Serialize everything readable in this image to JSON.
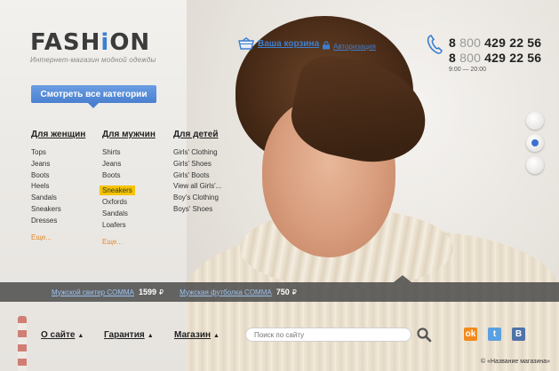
{
  "logo": {
    "word_pre": "FASH",
    "word_i": "i",
    "word_post": "ON",
    "tagline": "Интернет-магазин модной одежды"
  },
  "header": {
    "cart_label": "Ваша корзина",
    "auth_label": "Авторизация",
    "phones": [
      {
        "prefix": "8",
        "code": "800",
        "number": "429 22 56"
      },
      {
        "prefix": "8",
        "code": "800",
        "number": "429 22 56"
      }
    ],
    "hours": "9:00 — 20:00"
  },
  "categories_button": "Смотреть все категории",
  "columns": [
    {
      "title": "Для женщин",
      "items": [
        "Tops",
        "Jeans",
        "Boots",
        "Heels",
        "Sandals",
        "Sneakers",
        "Dresses"
      ],
      "more": "Еще..."
    },
    {
      "title": "Для мужчин",
      "items": [
        "Shirts",
        "Jeans",
        "Boots",
        "Sneakers",
        "Oxfords",
        "Sandals",
        "Loafers"
      ],
      "highlighted_index": 3,
      "more": "Еще..."
    },
    {
      "title": "Для детей",
      "items": [
        "Girls' Clothing",
        "Girls' Shoes",
        "Girls' Boots",
        "View all Girls'...",
        "Boy's Clothing",
        "Boys' Shoes"
      ]
    }
  ],
  "slider": {
    "count": 3,
    "active_index": 1
  },
  "promos": [
    {
      "name": "Мужской свитер COMMA",
      "price": "1599",
      "currency": "₽"
    },
    {
      "name": "Мужская футболка COMMA",
      "price": "750",
      "currency": "₽"
    }
  ],
  "footer": {
    "nav": [
      "О сайте",
      "Гарантия",
      "Магазин"
    ],
    "search_placeholder": "Поиск по сайту",
    "social": [
      {
        "icon": "odnoklassniki-icon",
        "glyph": "ok",
        "color": "#f28a1c"
      },
      {
        "icon": "twitter-icon",
        "glyph": "t",
        "color": "#5aa0e0"
      },
      {
        "icon": "vk-icon",
        "glyph": "В",
        "color": "#4e73a8"
      }
    ],
    "copyright": "© «Название магазина»"
  },
  "colors": {
    "accent": "#3d7fd0",
    "highlight": "#f4c400",
    "more_link": "#e28a2c",
    "strip": "#464646"
  }
}
